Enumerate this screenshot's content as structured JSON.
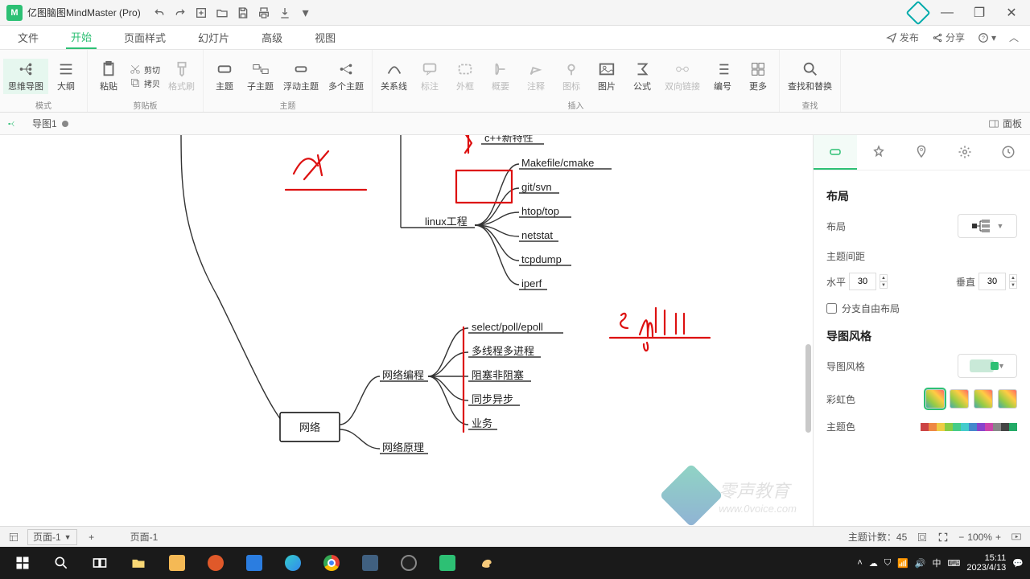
{
  "app": {
    "title": "亿图脑图MindMaster (Pro)"
  },
  "menu": {
    "file": "文件",
    "start": "开始",
    "pagestyle": "页面样式",
    "slide": "幻灯片",
    "advanced": "高级",
    "view": "视图",
    "publish": "发布",
    "share": "分享"
  },
  "ribbon": {
    "mode": {
      "label": "模式",
      "mindmap": "思维导图",
      "outline": "大纲"
    },
    "clipboard": {
      "label": "剪贴板",
      "paste": "粘贴",
      "cut": "剪切",
      "copy": "拷贝",
      "format": "格式刷"
    },
    "topic": {
      "label": "主题",
      "topic": "主题",
      "sub": "子主题",
      "float": "浮动主题",
      "multi": "多个主题"
    },
    "insert": {
      "label": "插入",
      "relation": "关系线",
      "callout": "标注",
      "boundary": "外框",
      "summary": "概要",
      "note": "注释",
      "mapicon": "图标",
      "image": "图片",
      "formula": "公式",
      "hyperlink": "双向链接",
      "numbering": "编号",
      "more": "更多"
    },
    "find": {
      "label": "查找",
      "findreplace": "查找和替换"
    }
  },
  "doctab": {
    "name": "导图1"
  },
  "panel_toggle": "面板",
  "status": {
    "page_sel": "页面-1",
    "page_name": "页面-1",
    "topic_count_label": "主题计数：",
    "topic_count": "45",
    "zoom": "100%"
  },
  "panel": {
    "layout_title": "布局",
    "layout_label": "布局",
    "spacing_label": "主题间距",
    "h_label": "水平",
    "h_val": "30",
    "v_label": "垂直",
    "v_val": "30",
    "free_layout": "分支自由布局",
    "style_title": "导图风格",
    "style_label": "导图风格",
    "rainbow_label": "彩虹色",
    "theme_color_label": "主题色"
  },
  "mind": {
    "root": "网络",
    "n_cpp": "c++新特性",
    "n_linux": "linux工程",
    "l_make": "Makefile/cmake",
    "l_git": "git/svn",
    "l_htop": "htop/top",
    "l_netstat": "netstat",
    "l_tcpdump": "tcpdump",
    "l_iperf": "iperf",
    "n_netprog": "网络编程",
    "p_select": "select/poll/epoll",
    "p_thread": "多线程多进程",
    "p_block": "阻塞非阻塞",
    "p_sync": "同步异步",
    "p_biz": "业务",
    "n_netprinc": "网络原理"
  },
  "taskbar": {
    "time": "15:11",
    "date": "2023/4/13",
    "ime": "中"
  },
  "watermark": {
    "text": "零声教育",
    "url": "www.0voice.com"
  }
}
